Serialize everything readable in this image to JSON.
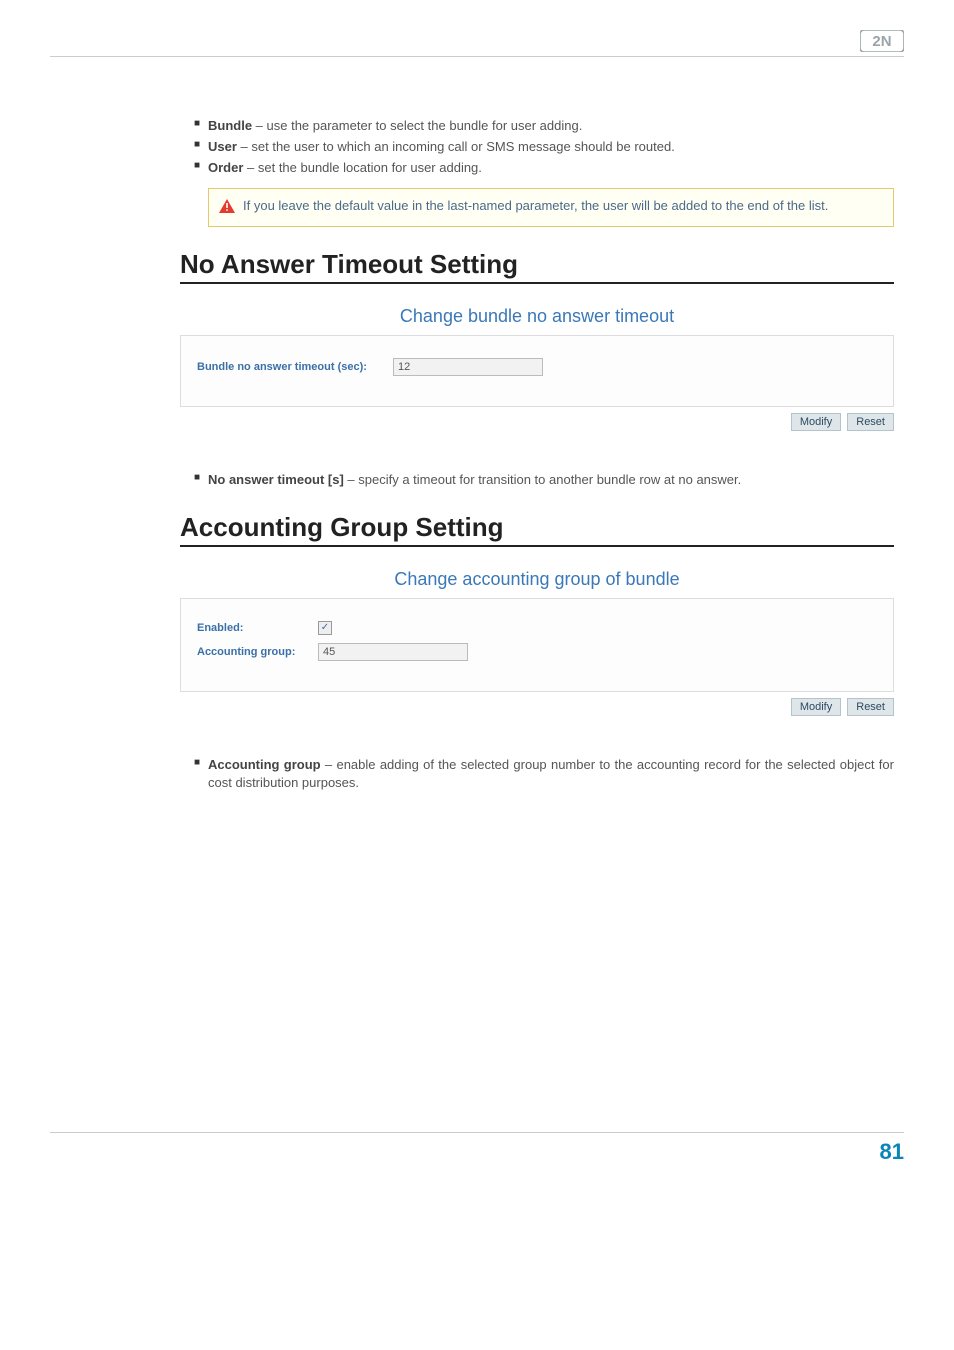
{
  "bullets_top": [
    {
      "term": "Bundle",
      "desc": " – use the parameter to select the bundle for user adding."
    },
    {
      "term": "User",
      "desc": " – set the user to which an incoming call or SMS message should be routed."
    },
    {
      "term": "Order",
      "desc": " – set the bundle location for user adding."
    }
  ],
  "callout": "If you leave the default value in the last-named parameter, the user will be added to the end of the list.",
  "section1_title": "No Answer Timeout Setting",
  "panel1_title": "Change bundle no answer timeout",
  "panel1_label": "Bundle no answer timeout (sec):",
  "panel1_value": "12",
  "modify_label": "Modify",
  "reset_label": "Reset",
  "bullets_mid": [
    {
      "term": "No answer timeout [s]",
      "desc": " – specify a timeout for transition to another bundle row at no answer."
    }
  ],
  "section2_title": "Accounting Group Setting",
  "panel2_title": "Change accounting group of bundle",
  "panel2_enabled_label": "Enabled:",
  "panel2_group_label": "Accounting group:",
  "panel2_group_value": "45",
  "bullets_bot": [
    {
      "term": "Accounting group",
      "desc": " – enable adding of the selected group number to the accounting record for the selected object for cost distribution purposes."
    }
  ],
  "page_number": "81"
}
